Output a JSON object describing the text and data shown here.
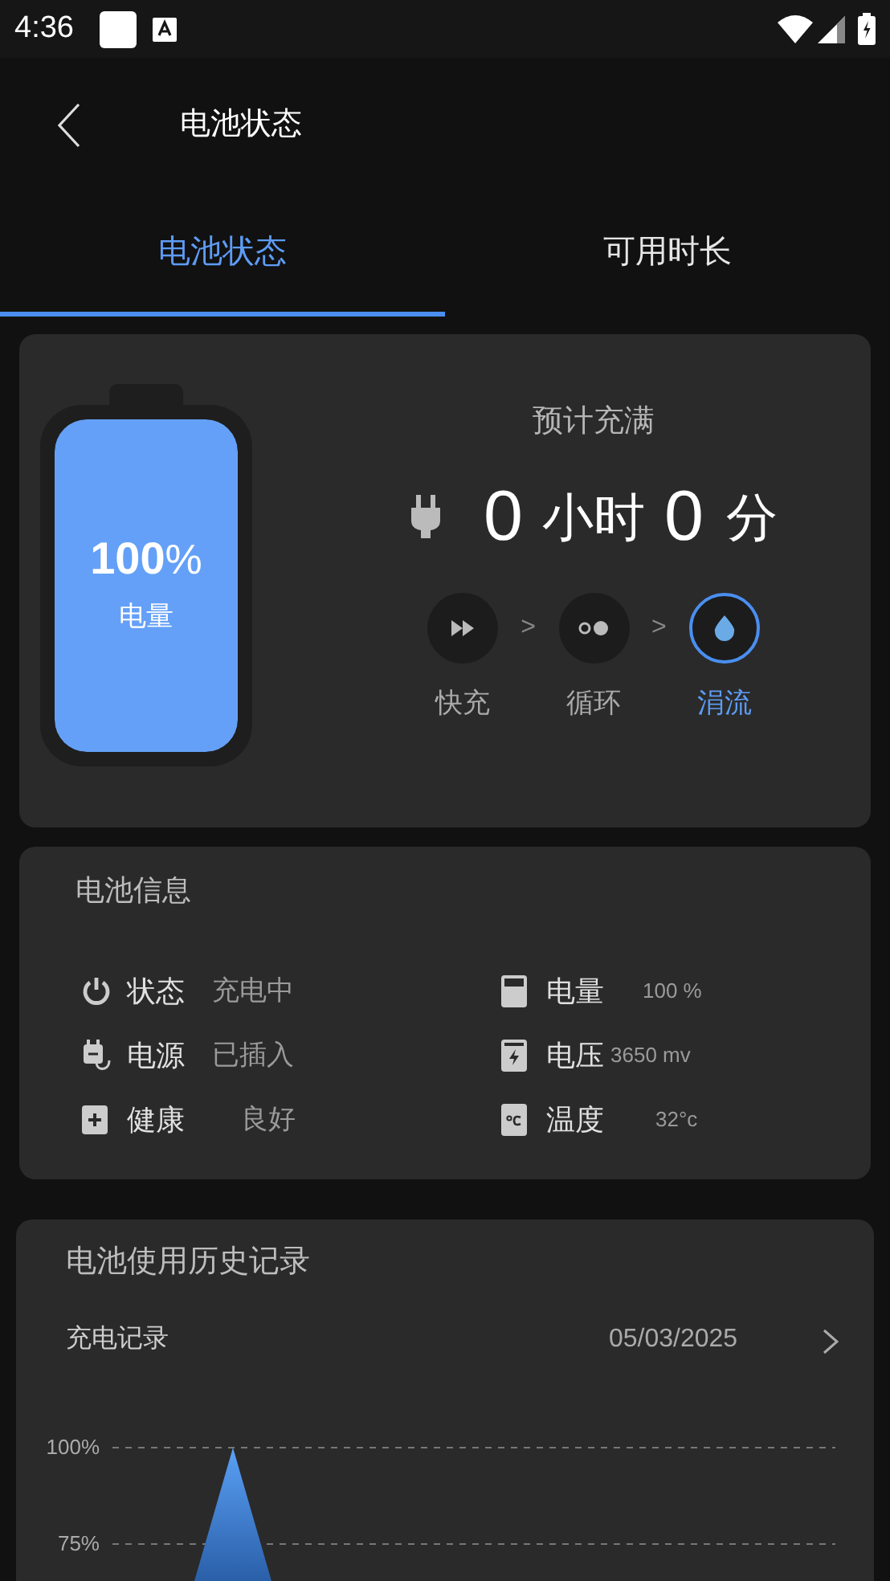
{
  "status_bar": {
    "time": "4:36"
  },
  "header": {
    "title": "电池状态"
  },
  "tabs": [
    {
      "label": "电池状态",
      "selected": true
    },
    {
      "label": "可用时长",
      "selected": false
    }
  ],
  "charge_card": {
    "battery": {
      "percent": "100",
      "unit": "%",
      "caption": "电量",
      "level": 1
    },
    "title": "预计充满",
    "hours": "0",
    "hours_unit": "小时",
    "minutes": "0",
    "minutes_unit": "分",
    "separators": [
      ">",
      ">"
    ],
    "modes": [
      {
        "kind": "fast",
        "label": "快充",
        "selected": false
      },
      {
        "kind": "cycle",
        "label": "循环",
        "selected": false
      },
      {
        "kind": "trickle",
        "label": "涓流",
        "selected": true
      }
    ]
  },
  "info_card": {
    "title": "电池信息",
    "items": [
      {
        "kind": "power",
        "label": "状态",
        "value": "充电中"
      },
      {
        "kind": "battery",
        "label": "电量",
        "value": "100 %"
      },
      {
        "kind": "plug",
        "label": "电源",
        "value": "已插入"
      },
      {
        "kind": "voltage",
        "label": "电压",
        "value": "3650 mv"
      },
      {
        "kind": "health",
        "label": "健康",
        "value": "良好"
      },
      {
        "kind": "temperature",
        "label": "温度",
        "value": "32°c"
      }
    ]
  },
  "history_card": {
    "title": "电池使用历史记录",
    "subtitle": "充电记录",
    "date": "05/03/2025",
    "axis_labels": [
      "100%",
      "75%"
    ]
  }
}
